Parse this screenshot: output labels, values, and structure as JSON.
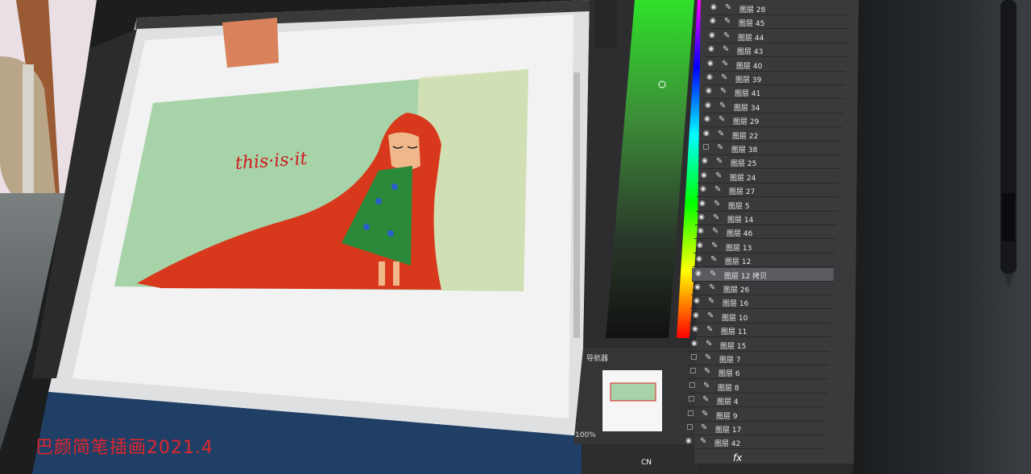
{
  "caption": "巴颜简笔插画2021.4",
  "artwork": {
    "handwriting": "this·is·it"
  },
  "photoshop": {
    "navigator_label": "导航器",
    "zoom": "100%",
    "layers": [
      {
        "label": "图层 28",
        "visible": true
      },
      {
        "label": "图层 45",
        "visible": true
      },
      {
        "label": "图层 44",
        "visible": true
      },
      {
        "label": "图层 43",
        "visible": true
      },
      {
        "label": "图层 40",
        "visible": true
      },
      {
        "label": "图层 39",
        "visible": true
      },
      {
        "label": "图层 41",
        "visible": true
      },
      {
        "label": "图层 34",
        "visible": true
      },
      {
        "label": "图层 29",
        "visible": true
      },
      {
        "label": "图层 22",
        "visible": true
      },
      {
        "label": "图层 38",
        "visible": false
      },
      {
        "label": "图层 25",
        "visible": true
      },
      {
        "label": "图层 24",
        "visible": true
      },
      {
        "label": "图层 27",
        "visible": true
      },
      {
        "label": "图层 5",
        "visible": true
      },
      {
        "label": "图层 14",
        "visible": true
      },
      {
        "label": "图层 46",
        "visible": true
      },
      {
        "label": "图层 13",
        "visible": true
      },
      {
        "label": "图层 12",
        "visible": true
      },
      {
        "label": "图层 12 拷贝",
        "visible": true,
        "selected": true
      },
      {
        "label": "图层 26",
        "visible": true
      },
      {
        "label": "图层 16",
        "visible": true
      },
      {
        "label": "图层 10",
        "visible": true
      },
      {
        "label": "图层 11",
        "visible": true
      },
      {
        "label": "图层 15",
        "visible": true
      },
      {
        "label": "图层 7",
        "visible": false
      },
      {
        "label": "图层 6",
        "visible": false
      },
      {
        "label": "图层 8",
        "visible": false
      },
      {
        "label": "图层 4",
        "visible": false
      },
      {
        "label": "图层 9",
        "visible": false
      },
      {
        "label": "图层 17",
        "visible": false
      },
      {
        "label": "图层 42",
        "visible": true
      }
    ],
    "layer_footer": "fx"
  },
  "taskbar": {
    "tray_lang": "CN"
  },
  "colors": {
    "caption": "#e0262b",
    "hair": "#d8391c",
    "green_bg": "#9fd4a4",
    "dress": "#2a8a3a"
  }
}
